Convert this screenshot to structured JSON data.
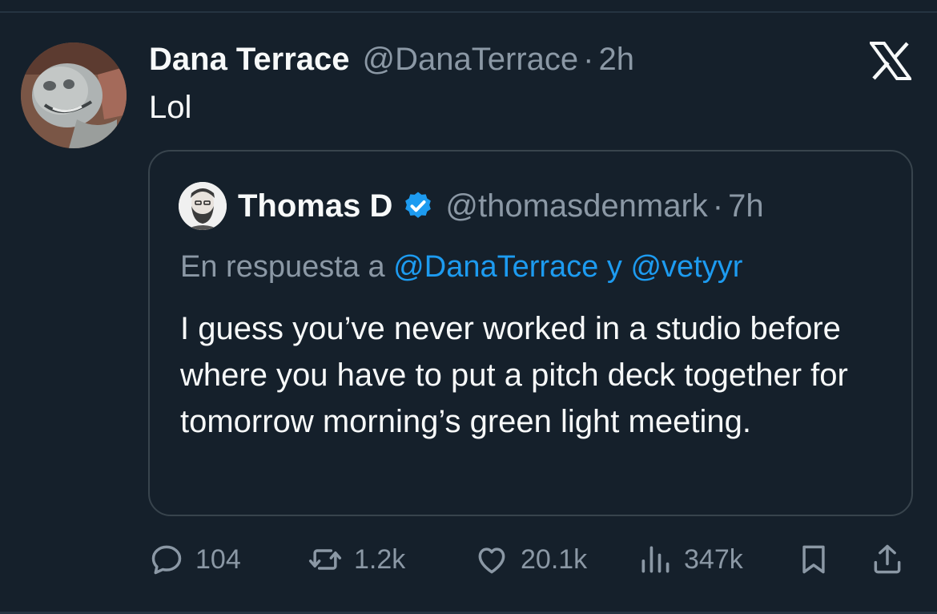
{
  "tweet": {
    "display_name": "Dana Terrace",
    "handle": "@DanaTerrace",
    "separator": "·",
    "time": "2h",
    "text": "Lol"
  },
  "quoted": {
    "display_name": "Thomas D",
    "handle": "@thomasdenmark",
    "separator": "·",
    "time": "7h",
    "reply_prefix": "En respuesta a ",
    "reply_mention_1": "@DanaTerrace",
    "reply_joiner": " y ",
    "reply_mention_2": "@vetyyr",
    "text": "I guess you’ve never worked in a studio before where you have to put a pitch deck together for tomorrow morning’s green light meeting."
  },
  "stats": {
    "replies": "104",
    "reposts": "1.2k",
    "likes": "20.1k",
    "views": "347k"
  },
  "icons": {
    "brand": "x-logo-icon",
    "verified": "verified-badge-icon",
    "reply": "reply-icon",
    "repost": "repost-icon",
    "like": "heart-icon",
    "views": "views-chart-icon",
    "bookmark": "bookmark-icon",
    "share": "share-icon"
  },
  "colors": {
    "background": "#15202b",
    "text": "#f7f9f9",
    "muted": "#8b98a5",
    "accent": "#1d9bf0",
    "border": "#38444d"
  }
}
